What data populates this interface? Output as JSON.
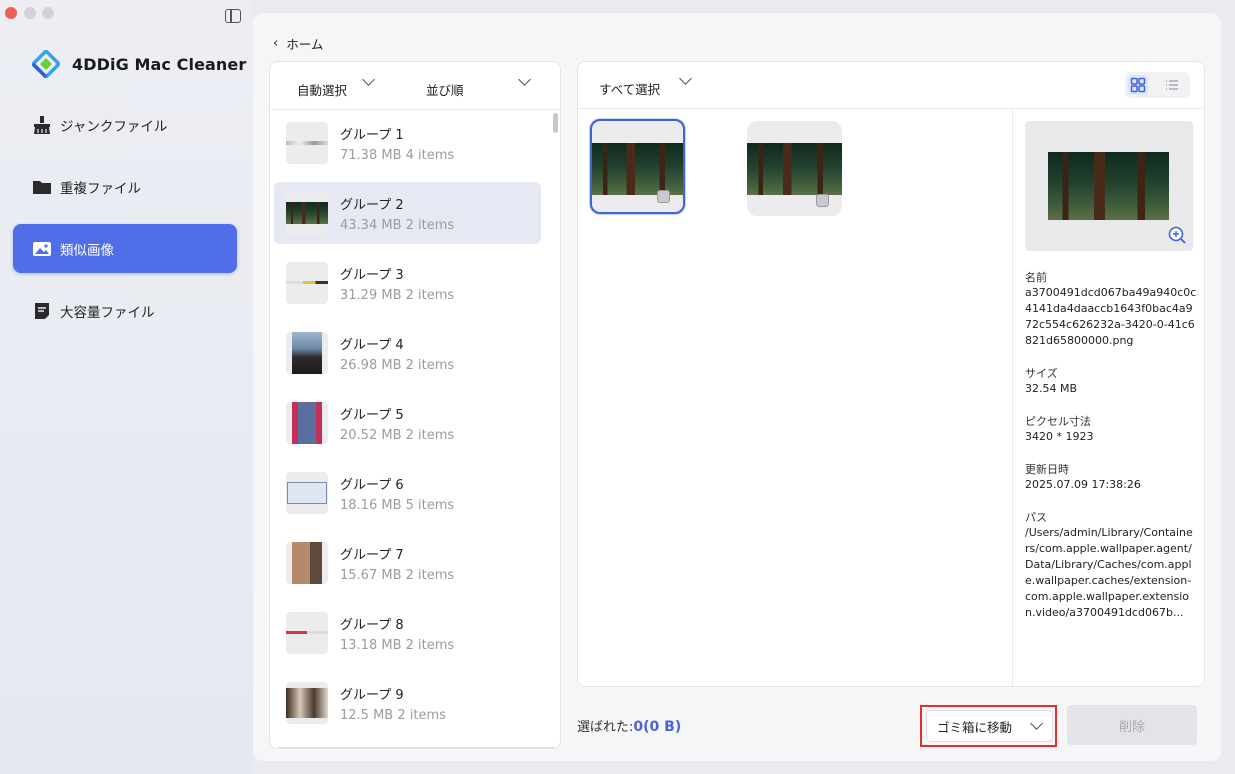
{
  "app": {
    "name": "4DDiG Mac Cleaner"
  },
  "sidebar": {
    "items": [
      {
        "label": "ジャンクファイル",
        "icon": "broom-icon"
      },
      {
        "label": "重複ファイル",
        "icon": "folder-icon"
      },
      {
        "label": "類似画像",
        "icon": "image-icon",
        "active": true
      },
      {
        "label": "大容量ファイル",
        "icon": "document-icon"
      }
    ]
  },
  "header": {
    "back_label": "ホーム"
  },
  "groups_panel": {
    "auto_select": "自動選択",
    "sort": "並び順",
    "groups": [
      {
        "name": "グループ 1",
        "size": "71.38  MB",
        "count": "4 items"
      },
      {
        "name": "グループ 2",
        "size": "43.34  MB",
        "count": "2 items",
        "selected": true
      },
      {
        "name": "グループ 3",
        "size": "31.29  MB",
        "count": "2 items"
      },
      {
        "name": "グループ 4",
        "size": "26.98  MB",
        "count": "2 items"
      },
      {
        "name": "グループ 5",
        "size": "20.52  MB",
        "count": "2 items"
      },
      {
        "name": "グループ 6",
        "size": "18.16  MB",
        "count": "5 items"
      },
      {
        "name": "グループ 7",
        "size": "15.67  MB",
        "count": "2 items"
      },
      {
        "name": "グループ 8",
        "size": "13.18  MB",
        "count": "2 items"
      },
      {
        "name": "グループ 9",
        "size": "12.5  MB",
        "count": "2 items"
      }
    ]
  },
  "images_panel": {
    "select_all": "すべて選択",
    "view_mode": "grid"
  },
  "details": {
    "name_label": "名前",
    "name_value": "a3700491dcd067ba49a940c0c4141da4daaccb1643f0bac4a972c554c626232a-3420-0-41c6821d65800000.png",
    "size_label": "サイズ",
    "size_value": "32.54  MB",
    "pixel_label": "ピクセル寸法",
    "pixel_value": "3420 * 1923",
    "date_label": "更新日時",
    "date_value": "2025.07.09 17:38:26",
    "path_label": "パス",
    "path_value": "/Users/admin/Library/Containers/com.apple.wallpaper.agent/Data/Library/Caches/com.apple.wallpaper.caches/extension-com.apple.wallpaper.extension.video/a3700491dcd067b..."
  },
  "footer": {
    "selected_label": "選ばれた:",
    "selected_value": "0(0  B)",
    "trash_label": "ゴミ箱に移動",
    "delete_label": "削除"
  },
  "colors": {
    "accent": "#4f6ee8",
    "highlight": "#e0312c"
  }
}
